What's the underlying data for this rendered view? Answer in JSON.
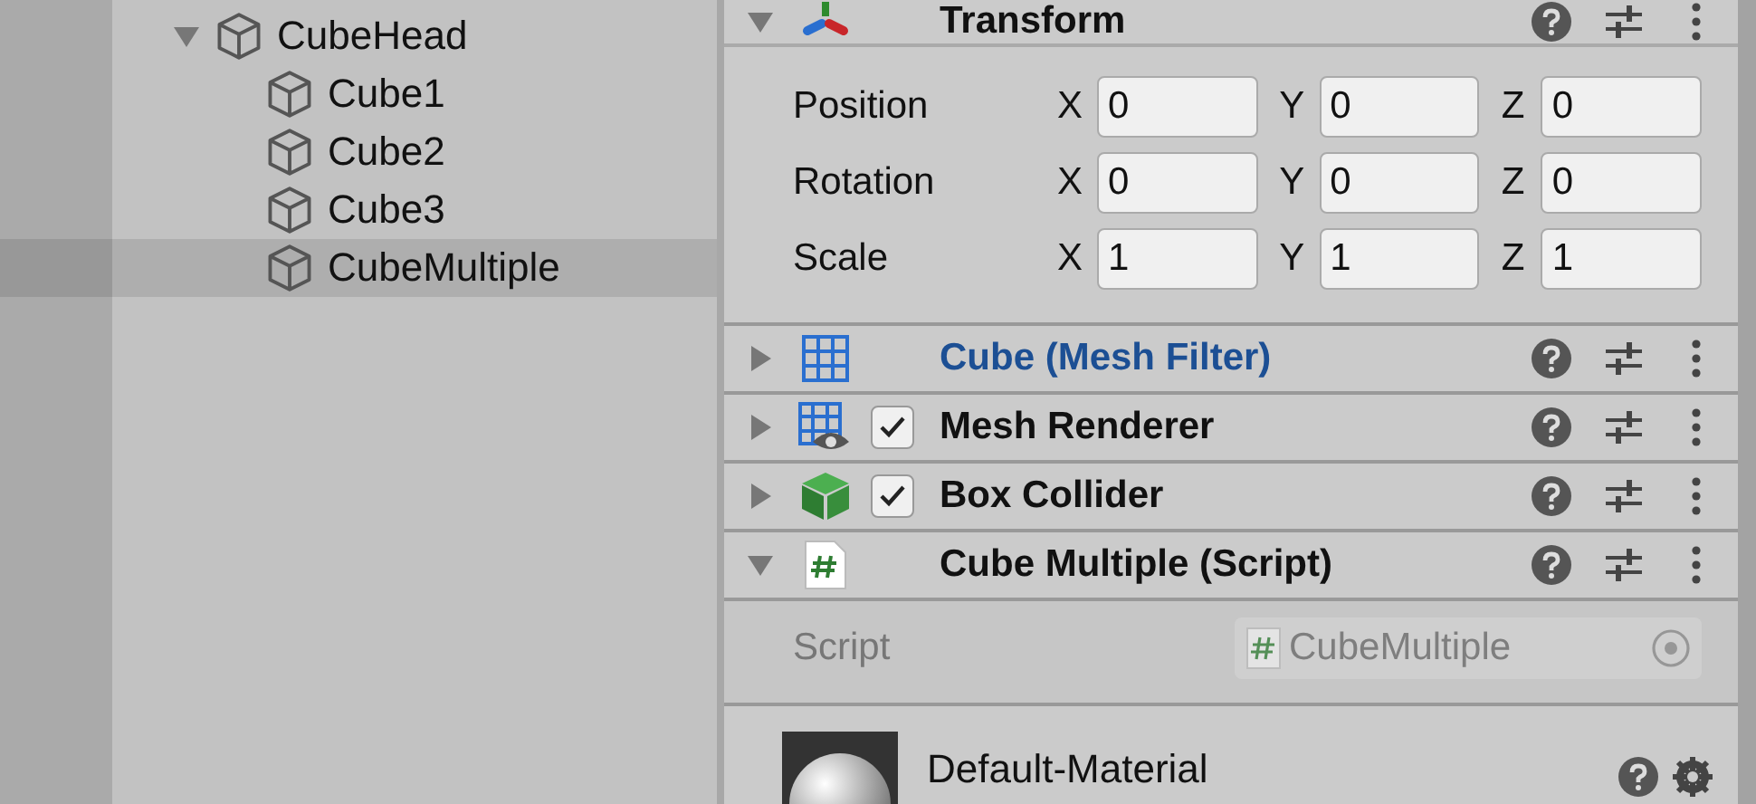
{
  "hierarchy": {
    "items": [
      {
        "label": "CubeHead",
        "expanded": true,
        "selected": false,
        "children": [
          {
            "label": "Cube1",
            "selected": false
          },
          {
            "label": "Cube2",
            "selected": false
          },
          {
            "label": "Cube3",
            "selected": false
          },
          {
            "label": "CubeMultiple",
            "selected": true
          }
        ]
      }
    ]
  },
  "inspector": {
    "components": [
      {
        "kind": "transform",
        "title": "Transform",
        "expanded": true,
        "modified": false,
        "rows": [
          {
            "label": "Position",
            "fields": [
              {
                "axis": "X",
                "value": "0"
              },
              {
                "axis": "Y",
                "value": "0"
              },
              {
                "axis": "Z",
                "value": "0"
              }
            ]
          },
          {
            "label": "Rotation",
            "fields": [
              {
                "axis": "X",
                "value": "0"
              },
              {
                "axis": "Y",
                "value": "0"
              },
              {
                "axis": "Z",
                "value": "0"
              }
            ]
          },
          {
            "label": "Scale",
            "fields": [
              {
                "axis": "X",
                "value": "1"
              },
              {
                "axis": "Y",
                "value": "1"
              },
              {
                "axis": "Z",
                "value": "1"
              }
            ]
          }
        ]
      },
      {
        "kind": "mesh-filter",
        "title": "Cube (Mesh Filter)",
        "expanded": false,
        "modified": true
      },
      {
        "kind": "mesh-renderer",
        "title": "Mesh Renderer",
        "expanded": false,
        "modified": false,
        "enabled": true
      },
      {
        "kind": "box-collider",
        "title": "Box Collider",
        "expanded": false,
        "modified": false,
        "enabled": true
      },
      {
        "kind": "script",
        "title": "Cube Multiple (Script)",
        "expanded": true,
        "modified": false,
        "fields": [
          {
            "label": "Script",
            "value": "CubeMultiple",
            "disabled": true
          }
        ]
      }
    ],
    "material": {
      "name": "Default-Material"
    }
  }
}
